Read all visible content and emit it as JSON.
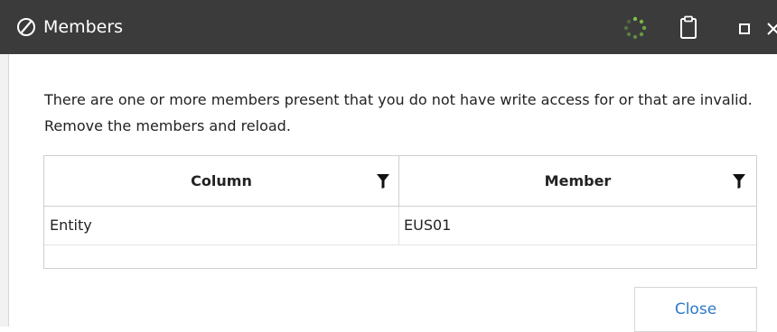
{
  "window": {
    "title": "Members",
    "icons": {
      "logo": "app-logo-icon",
      "loading": "spinner-icon",
      "clipboard": "clipboard-icon",
      "maximize": "maximize-icon",
      "close": "close-icon"
    }
  },
  "message": "There are one or more members present that you do not have write access for or that are invalid.  Remove the members and reload.",
  "grid": {
    "columns": [
      "Column",
      "Member"
    ],
    "rows": [
      [
        "Entity",
        "EUS01"
      ]
    ]
  },
  "footer": {
    "close_label": "Close"
  },
  "colors": {
    "titlebar": "#3b3b3b",
    "accent": "#2d78c8",
    "spinner": "#7cc24a"
  }
}
